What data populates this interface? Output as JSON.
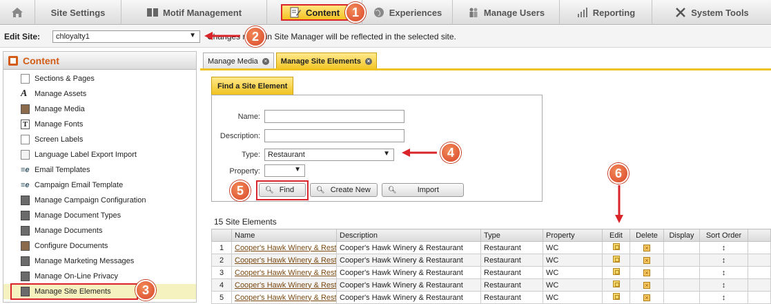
{
  "topnav": {
    "items": [
      {
        "label": "Site Settings",
        "icon": "none"
      },
      {
        "label": "Motif Management",
        "icon": "motif-icon"
      },
      {
        "label": "Content",
        "icon": "content-icon"
      },
      {
        "label": "Experiences",
        "icon": "globe-icon"
      },
      {
        "label": "Manage Users",
        "icon": "users-icon"
      },
      {
        "label": "Reporting",
        "icon": "bar-chart-icon"
      },
      {
        "label": "System Tools",
        "icon": "tools-icon"
      }
    ]
  },
  "editsite": {
    "label": "Edit Site:",
    "selected": "chloyalty1",
    "message": "Changes made in Site Manager will be reflected in the selected site."
  },
  "sidebar": {
    "title": "Content",
    "items": [
      {
        "label": "Sections & Pages"
      },
      {
        "label": "Manage Assets"
      },
      {
        "label": "Manage Media"
      },
      {
        "label": "Manage Fonts"
      },
      {
        "label": "Screen Labels"
      },
      {
        "label": "Language Label Export Import"
      },
      {
        "label": "Email Templates"
      },
      {
        "label": "Campaign Email Template"
      },
      {
        "label": "Manage Campaign Configuration"
      },
      {
        "label": "Manage Document Types"
      },
      {
        "label": "Manage Documents"
      },
      {
        "label": "Configure Documents"
      },
      {
        "label": "Manage Marketing Messages"
      },
      {
        "label": "Manage On-Line Privacy"
      },
      {
        "label": "Manage Site Elements"
      }
    ]
  },
  "tabs": [
    {
      "label": "Manage Media"
    },
    {
      "label": "Manage Site Elements"
    }
  ],
  "find": {
    "title": "Find a Site Element",
    "name_label": "Name:",
    "name_value": "",
    "description_label": "Description:",
    "description_value": "",
    "type_label": "Type:",
    "type_value": "Restaurant",
    "property_label": "Property:",
    "property_value": "",
    "find_button": "Find",
    "create_button": "Create New",
    "import_button": "Import"
  },
  "results": {
    "count_text": "15 Site Elements",
    "columns": [
      "",
      "Name",
      "Description",
      "Type",
      "Property",
      "Edit",
      "Delete",
      "Display",
      "Sort Order"
    ],
    "rows": [
      {
        "num": "1",
        "name": "Cooper's Hawk Winery & Restaurant",
        "description": "Cooper's Hawk Winery & Restaurant",
        "type": "Restaurant",
        "property": "WC"
      },
      {
        "num": "2",
        "name": "Cooper's Hawk Winery & Restaurant",
        "description": "Cooper's Hawk Winery & Restaurant",
        "type": "Restaurant",
        "property": "WC"
      },
      {
        "num": "3",
        "name": "Cooper's Hawk Winery & Restaurant",
        "description": "Cooper's Hawk Winery & Restaurant",
        "type": "Restaurant",
        "property": "WC"
      },
      {
        "num": "4",
        "name": "Cooper's Hawk Winery & Restaurant",
        "description": "Cooper's Hawk Winery & Restaurant",
        "type": "Restaurant",
        "property": "WC"
      },
      {
        "num": "5",
        "name": "Cooper's Hawk Winery & Restaurant",
        "description": "Cooper's Hawk Winery & Restaurant",
        "type": "Restaurant",
        "property": "WC"
      }
    ]
  },
  "callouts": [
    "1",
    "2",
    "3",
    "4",
    "5",
    "6"
  ],
  "colors": {
    "accent": "#f0c21f",
    "callout": "#d9462a",
    "highlight_box": "#d9252a"
  }
}
